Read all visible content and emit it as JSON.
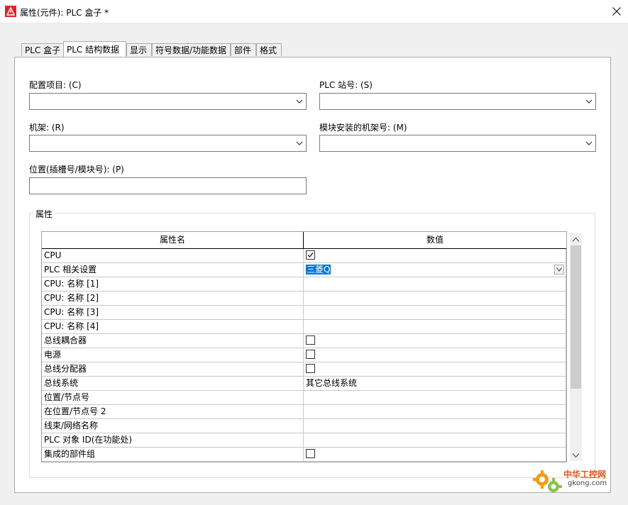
{
  "window": {
    "title": "属性(元件): PLC 盒子 *",
    "close_icon": "close-icon",
    "app_icon": "eplan-warning-icon"
  },
  "tabs": [
    {
      "label": "PLC 盒子",
      "active": false
    },
    {
      "label": "PLC 结构数据",
      "active": true
    },
    {
      "label": "显示",
      "active": false
    },
    {
      "label": "符号数据/功能数据",
      "active": false
    },
    {
      "label": "部件",
      "active": false
    },
    {
      "label": "格式",
      "active": false
    }
  ],
  "fields": {
    "config_item": {
      "label": "配置项目: (C)",
      "value": ""
    },
    "plc_station": {
      "label": "PLC 站号: (S)",
      "value": ""
    },
    "rack": {
      "label": "机架: (R)",
      "value": ""
    },
    "module_rack": {
      "label": "模块安装的机架号: (M)",
      "value": ""
    },
    "position": {
      "label": "位置(插槽号/模块号): (P)",
      "value": ""
    }
  },
  "properties": {
    "group_label": "属性",
    "columns": [
      "属性名",
      "数值"
    ],
    "rows": [
      {
        "name": "CPU",
        "kind": "checkbox",
        "checked": true,
        "value": ""
      },
      {
        "name": "PLC 相关设置",
        "kind": "dropdown",
        "value": "三菱Q"
      },
      {
        "name": "CPU: 名称 [1]",
        "kind": "text",
        "value": ""
      },
      {
        "name": "CPU: 名称 [2]",
        "kind": "text",
        "value": ""
      },
      {
        "name": "CPU: 名称 [3]",
        "kind": "text",
        "value": ""
      },
      {
        "name": "CPU: 名称 [4]",
        "kind": "text",
        "value": ""
      },
      {
        "name": "总线耦合器",
        "kind": "checkbox",
        "checked": false,
        "value": ""
      },
      {
        "name": "电源",
        "kind": "checkbox",
        "checked": false,
        "value": ""
      },
      {
        "name": "总线分配器",
        "kind": "checkbox",
        "checked": false,
        "value": ""
      },
      {
        "name": "总线系统",
        "kind": "text",
        "value": "其它总线系统"
      },
      {
        "name": "位置/节点号",
        "kind": "text",
        "value": ""
      },
      {
        "name": "在位置/节点号 2",
        "kind": "text",
        "value": ""
      },
      {
        "name": "线束/网络名称",
        "kind": "text",
        "value": ""
      },
      {
        "name": "PLC 对象 ID(在功能处)",
        "kind": "text",
        "value": ""
      },
      {
        "name": "集成的部件组",
        "kind": "checkbox",
        "checked": false,
        "value": ""
      }
    ]
  },
  "watermark": {
    "cn": "中华工控网",
    "en": "gkong.com"
  },
  "colors": {
    "selection": "#0078d7",
    "watermark": "#e8501e"
  }
}
